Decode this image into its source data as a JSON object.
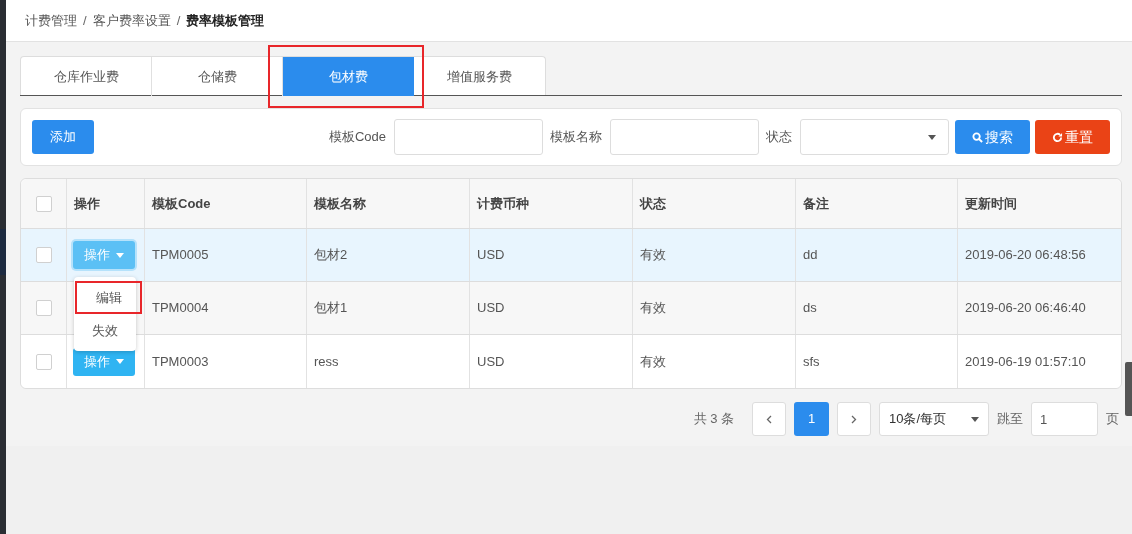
{
  "breadcrumb": [
    {
      "label": "计费管理",
      "current": false
    },
    {
      "label": "客户费率设置",
      "current": false
    },
    {
      "label": "费率模板管理",
      "current": true
    }
  ],
  "breadcrumb_separator": "/",
  "tabs": [
    {
      "label": "仓库作业费",
      "selected": false,
      "annotated": false
    },
    {
      "label": "仓储费",
      "selected": false,
      "annotated": false
    },
    {
      "label": "包材费",
      "selected": true,
      "annotated": true
    },
    {
      "label": "增值服务费",
      "selected": false,
      "annotated": false
    }
  ],
  "toolbar": {
    "add_button": "添加",
    "filters": [
      {
        "label": "模板Code",
        "kind": "input"
      },
      {
        "label": "模板名称",
        "kind": "input"
      },
      {
        "label": "状态",
        "kind": "select"
      }
    ],
    "search_button": "搜索",
    "reset_button": "重置"
  },
  "table": {
    "header_checked": false,
    "columns": [
      "操作",
      "模板Code",
      "模板名称",
      "计费币种",
      "状态",
      "备注",
      "更新时间"
    ],
    "rows": [
      {
        "selected": true,
        "checked": false,
        "action": "操作",
        "code": "TPM0005",
        "name": "包材2",
        "currency": "USD",
        "status": "有效",
        "remark": "dd",
        "updated": "2019-06-20 06:48:56"
      },
      {
        "selected": false,
        "checked": false,
        "code": "TPM0004",
        "name": "包材1",
        "currency": "USD",
        "status": "有效",
        "remark": "ds",
        "updated": "2019-06-20 06:46:40"
      },
      {
        "selected": false,
        "checked": false,
        "action": "操作",
        "code": "TPM0003",
        "name": "ress",
        "currency": "USD",
        "status": "有效",
        "remark": "sfs",
        "updated": "2019-06-19 01:57:10"
      }
    ]
  },
  "action_menu": {
    "items": [
      {
        "label": "编辑",
        "annotated": true
      },
      {
        "label": "失效",
        "annotated": false
      }
    ]
  },
  "pagination": {
    "total": "共 3 条",
    "pages": [
      {
        "label": "1",
        "selected": true
      }
    ],
    "page_size": "10条/每页",
    "jump_label": "跳至",
    "jump_value": "1",
    "page_suffix": "页"
  }
}
